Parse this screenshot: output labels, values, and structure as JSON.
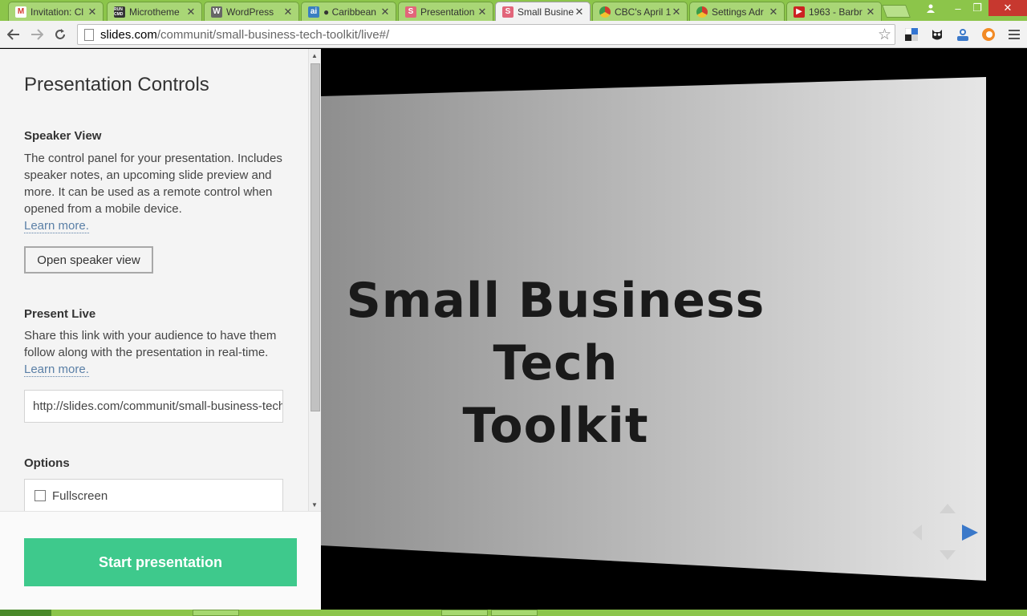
{
  "browser": {
    "tabs": [
      {
        "title": "Invitation: Cl",
        "favicon": "gmail-icon",
        "favicon_color": "#ffffff",
        "favicon_text": "M",
        "active": false
      },
      {
        "title": "Microtheme",
        "favicon": "runcmd-icon",
        "favicon_color": "#333333",
        "favicon_text": "RUN CMD",
        "active": false
      },
      {
        "title": "WordPress",
        "favicon": "wordpress-icon",
        "favicon_color": "#666666",
        "favicon_text": "W",
        "active": false
      },
      {
        "title": "● Caribbean",
        "favicon": "ai-icon",
        "favicon_color": "#3a7fc1",
        "favicon_text": "ai",
        "active": false
      },
      {
        "title": "Presentation",
        "favicon": "slides-icon",
        "favicon_color": "#e2657a",
        "favicon_text": "S",
        "active": false
      },
      {
        "title": "Small Busine",
        "favicon": "slides-icon",
        "favicon_color": "#e2657a",
        "favicon_text": "S",
        "active": true
      },
      {
        "title": "CBC's April 1",
        "favicon": "chrome-icon",
        "favicon_color": "#4a8f3c",
        "favicon_text": "",
        "active": false
      },
      {
        "title": "Settings Adr",
        "favicon": "chrome-icon",
        "favicon_color": "#4a8f3c",
        "favicon_text": "",
        "active": false
      },
      {
        "title": "1963 - Barbr",
        "favicon": "youtube-icon",
        "favicon_color": "#cc2222",
        "favicon_text": "▶",
        "active": false
      }
    ],
    "url_host": "slides.com",
    "url_path": "/communit/small-business-tech-toolkit/live#/",
    "window_controls": {
      "minimize": "–",
      "maximize": "❐",
      "close": "✕"
    }
  },
  "panel": {
    "title": "Presentation Controls",
    "speaker_view": {
      "heading": "Speaker View",
      "description": "The control panel for your presentation. Includes speaker notes, an upcoming slide preview and more. It can be used as a remote control when opened from a mobile device.",
      "learn_more": "Learn more.",
      "button_label": "Open speaker view"
    },
    "present_live": {
      "heading": "Present Live",
      "description": "Share this link with your audience to have them follow along with the presentation in real-time.",
      "learn_more": "Learn more.",
      "link_value": "http://slides.com/communit/small-business-tech-toolkit/live"
    },
    "options": {
      "heading": "Options",
      "fullscreen_label": "Fullscreen",
      "fullscreen_checked": false
    },
    "start_button_label": "Start presentation",
    "accent_color": "#3ec98c"
  },
  "slide": {
    "title_line1": "Small Business Tech",
    "title_line2": "Toolkit"
  },
  "colors": {
    "tabstrip": "#8cc54a",
    "nav_arrow_active": "#3a78c9",
    "link": "#5a7fa6"
  }
}
